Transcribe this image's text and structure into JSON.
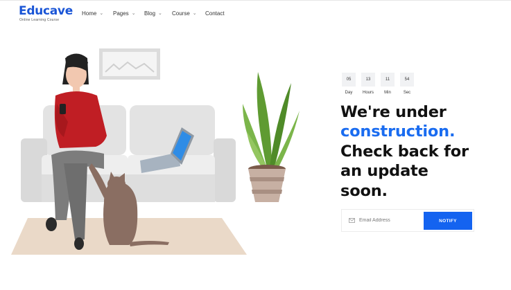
{
  "brand": {
    "name": "Educave",
    "tagline": "Online Learning Course"
  },
  "nav": {
    "items": [
      {
        "label": "Home",
        "dropdown": true
      },
      {
        "label": "Pages",
        "dropdown": true
      },
      {
        "label": "Blog",
        "dropdown": true
      },
      {
        "label": "Course",
        "dropdown": true
      },
      {
        "label": "Contact",
        "dropdown": false
      }
    ]
  },
  "countdown": {
    "units": [
      {
        "value": "05",
        "label": "Day"
      },
      {
        "value": "13",
        "label": "Hours"
      },
      {
        "value": "11",
        "label": "Min"
      },
      {
        "value": "54",
        "label": "Sec"
      }
    ]
  },
  "headline": {
    "line1": "We're under",
    "line2": "construction.",
    "line3": "Check back for",
    "line4": "an update",
    "line5": "soon."
  },
  "subscribe": {
    "placeholder": "Email Address",
    "button_label": "NOTIFY"
  },
  "icons": {
    "mail": "mail-icon",
    "chevron": "chevron-down-icon"
  },
  "colors": {
    "brand": "#1a55d6",
    "accent": "#1a6cf0",
    "button": "#1463f0"
  }
}
